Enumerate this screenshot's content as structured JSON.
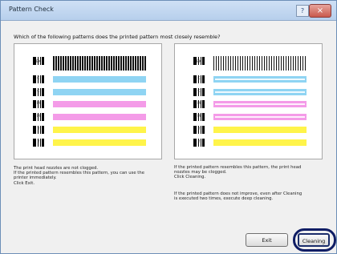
{
  "window": {
    "title": "Pattern Check"
  },
  "question": "Which of the following patterns does the printed pattern most closely resemble?",
  "left_panel": {
    "labels": [
      "BK",
      "C",
      "C",
      "M",
      "M",
      "Y",
      "Y"
    ],
    "description": [
      "The print head nozzles are not clogged.",
      "If the printed pattern resembles this pattern, you can use the",
      "printer immediately.",
      "Click Exit."
    ]
  },
  "right_panel": {
    "labels": [
      "BK",
      "C",
      "C",
      "M",
      "M",
      "Y",
      "Y"
    ],
    "description_1": [
      "If the printed pattern resembles this pattern, the print head",
      "nozzles may be clogged.",
      "Click Cleaning."
    ],
    "description_2": [
      "If the printed pattern does not improve, even after Cleaning",
      "is executed two times, execute deep cleaning."
    ]
  },
  "buttons": {
    "exit": "Exit",
    "cleaning": "Cleaning"
  },
  "colors": {
    "cyan": "#8fd4f3",
    "magenta": "#f49be8",
    "yellow": "#fff44a",
    "highlight_ring": "#0f1d65"
  }
}
